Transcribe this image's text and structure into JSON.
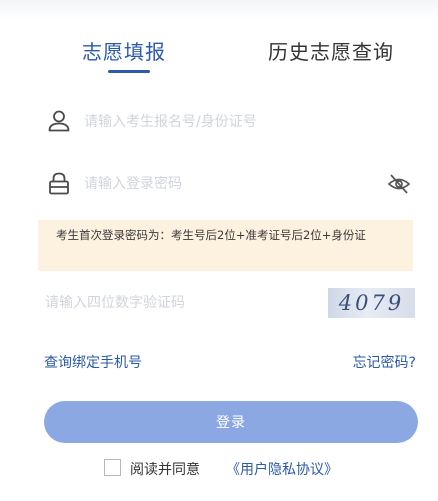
{
  "tabs": [
    {
      "label": "志愿填报",
      "active": true
    },
    {
      "label": "历史志愿查询",
      "active": false
    }
  ],
  "username": {
    "placeholder": "请输入考生报名号/身份证号",
    "icon": "user-icon",
    "value": ""
  },
  "password": {
    "placeholder": "请输入登录密码",
    "icon": "lock-icon",
    "toggle_icon": "eye-off-icon",
    "value": ""
  },
  "notice": {
    "text": "考生首次登录密码为：考生号后2位+准考证号后2位+身份证"
  },
  "captcha": {
    "placeholder": "请输入四位数字验证码",
    "code_image_text": "4079"
  },
  "links": {
    "bind_phone": "查询绑定手机号",
    "forgot_password": "忘记密码?"
  },
  "login_button": {
    "label": "登录"
  },
  "agreement": {
    "prefix": "阅读并同意",
    "link": "《用户隐私协议》",
    "checked": false
  },
  "colors": {
    "accent": "#2a5aa8",
    "button": "#8ca8e2",
    "notice_bg": "#fdf1e0"
  }
}
